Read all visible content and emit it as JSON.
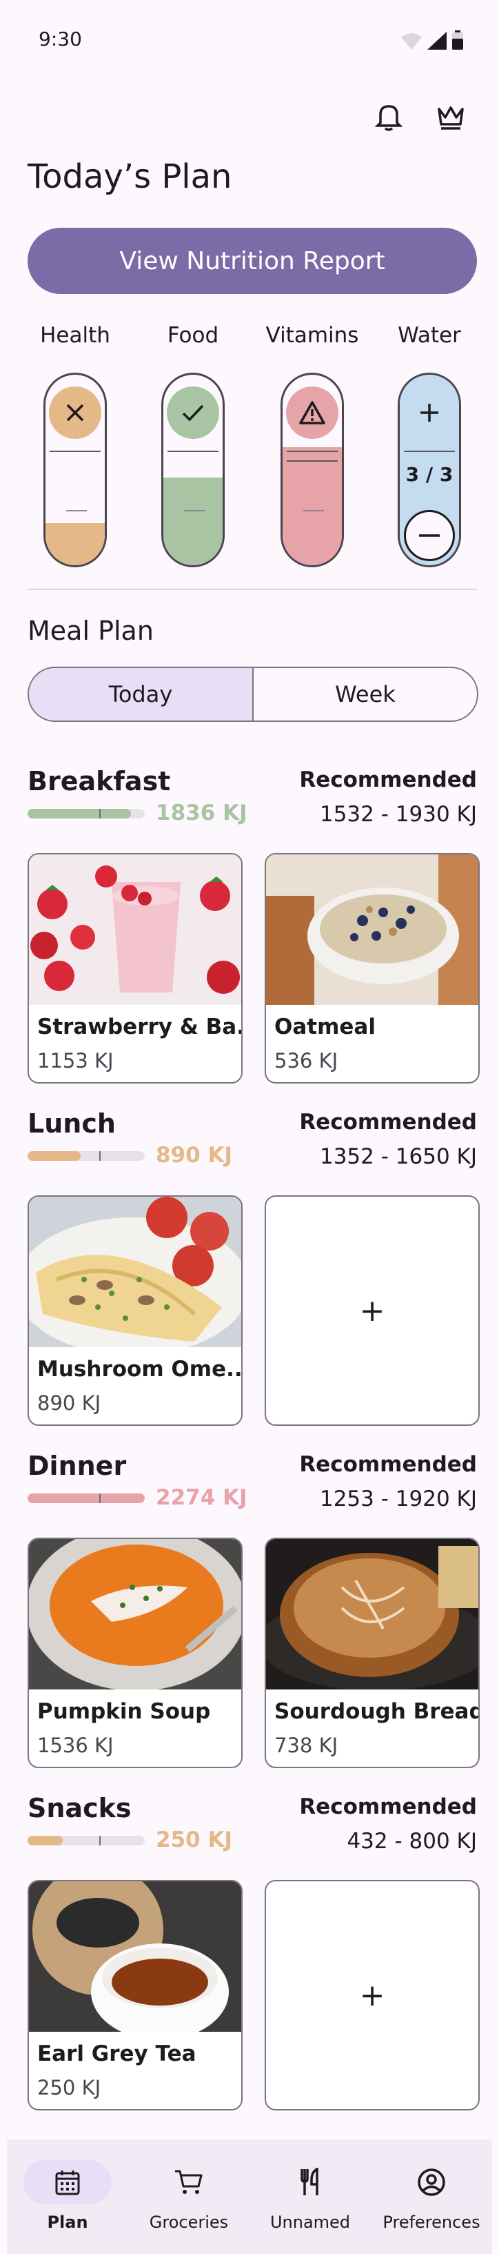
{
  "status": {
    "time": "9:30"
  },
  "header": {
    "title": "Today’s Plan",
    "report_button": "View Nutrition Report"
  },
  "metrics": [
    {
      "label": "Health",
      "icon": "close-icon",
      "color": "#e4b887",
      "fill": 0.22
    },
    {
      "label": "Food",
      "icon": "check-icon",
      "color": "#a9c4a2",
      "fill": 0.46
    },
    {
      "label": "Vitamins",
      "icon": "warning-icon",
      "color": "#e6a3a8",
      "fill": 0.62
    },
    {
      "label": "Water",
      "icon": "plus-icon",
      "color": "#c5dcf0",
      "counter": "3 / 3"
    }
  ],
  "meal_plan": {
    "label": "Meal Plan",
    "tabs": [
      "Today",
      "Week"
    ],
    "recommended_label": "Recommended",
    "meals": [
      {
        "title": "Breakfast",
        "kj": "1836 KJ",
        "color": "#a9c4a2",
        "fill": 0.88,
        "range": "1532 - 1930 KJ",
        "items": [
          {
            "name": "Strawberry & Ba..",
            "kj": "1153 KJ"
          },
          {
            "name": "Oatmeal",
            "kj": "536 KJ"
          }
        ]
      },
      {
        "title": "Lunch",
        "kj": "890 KJ",
        "color": "#e4b887",
        "fill": 0.45,
        "range": "1352 - 1650 KJ",
        "items": [
          {
            "name": "Mushroom Ome..",
            "kj": "890 KJ"
          }
        ]
      },
      {
        "title": "Dinner",
        "kj": "2274 KJ",
        "color": "#e6a3a8",
        "fill": 1.0,
        "range": "1253 - 1920 KJ",
        "items": [
          {
            "name": "Pumpkin Soup",
            "kj": "1536 KJ"
          },
          {
            "name": "Sourdough Bread",
            "kj": "738 KJ"
          }
        ]
      },
      {
        "title": "Snacks",
        "kj": "250 KJ",
        "color": "#e4b887",
        "fill": 0.3,
        "range": "432 - 800 KJ",
        "items": [
          {
            "name": "Earl Grey Tea",
            "kj": "250 KJ"
          }
        ]
      }
    ],
    "add_symbol": "+"
  },
  "nav": [
    {
      "label": "Plan",
      "icon": "calendar-icon"
    },
    {
      "label": "Groceries",
      "icon": "cart-icon"
    },
    {
      "label": "Unnamed",
      "icon": "utensils-icon"
    },
    {
      "label": "Preferences",
      "icon": "account-icon"
    }
  ]
}
